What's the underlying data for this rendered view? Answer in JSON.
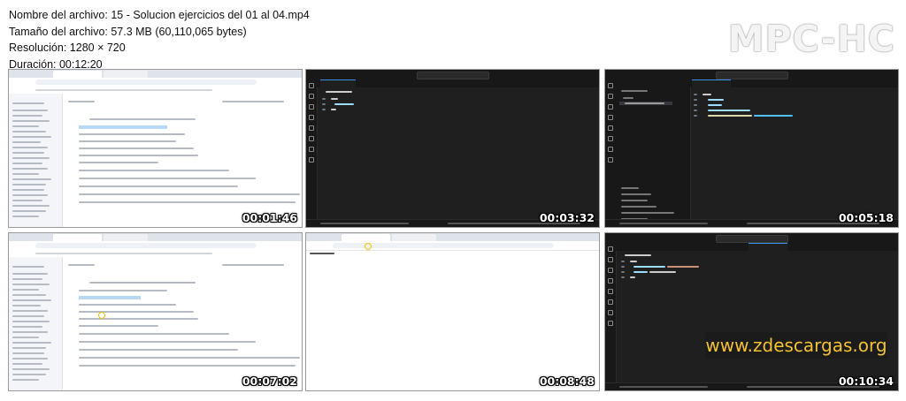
{
  "file_info": {
    "name_line": "Nombre del archivo: 15 - Solucion ejercicios del 01 al 04.mp4",
    "size_line": "Tamaño del archivo: 57.3 MB (60,110,065 bytes)",
    "resolution_line": "Resolución: 1280 × 720",
    "duration_line": "Duración: 00:12:20"
  },
  "brand": "MPC-HC",
  "watermark": "www.zdescargas.org",
  "thumbnails": [
    {
      "timestamp": "00:01:46",
      "kind": "browser"
    },
    {
      "timestamp": "00:03:32",
      "kind": "editor"
    },
    {
      "timestamp": "00:05:18",
      "kind": "editor"
    },
    {
      "timestamp": "00:07:02",
      "kind": "browser"
    },
    {
      "timestamp": "00:08:48",
      "kind": "blank-page"
    },
    {
      "timestamp": "00:10:34",
      "kind": "editor"
    }
  ],
  "colors": {
    "editor_bg": "#1f1f1f",
    "editor_accent": "#3794ff",
    "watermark_text": "#f2c230"
  }
}
